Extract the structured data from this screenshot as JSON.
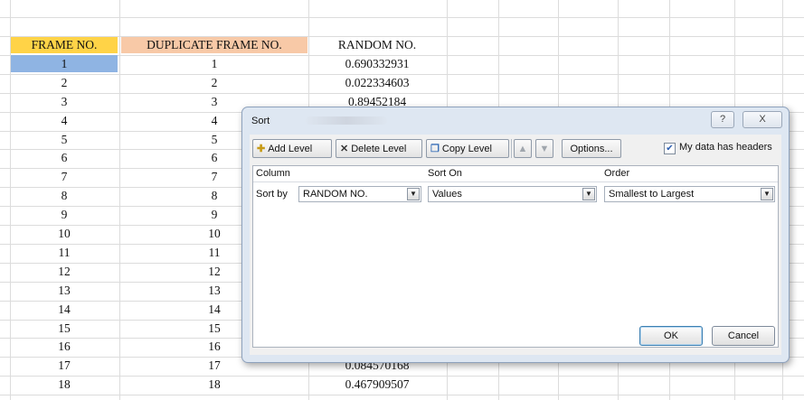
{
  "sheet": {
    "headers": {
      "col_a": "FRAME NO.",
      "col_b": "DUPLICATE FRAME NO.",
      "col_c": "RANDOM NO."
    },
    "rows": [
      {
        "a": "1",
        "b": "1",
        "c": "0.690332931"
      },
      {
        "a": "2",
        "b": "2",
        "c": "0.022334603"
      },
      {
        "a": "3",
        "b": "3",
        "c": "0.89452184"
      },
      {
        "a": "4",
        "b": "4",
        "c": ""
      },
      {
        "a": "5",
        "b": "5",
        "c": ""
      },
      {
        "a": "6",
        "b": "6",
        "c": ""
      },
      {
        "a": "7",
        "b": "7",
        "c": ""
      },
      {
        "a": "8",
        "b": "8",
        "c": ""
      },
      {
        "a": "9",
        "b": "9",
        "c": ""
      },
      {
        "a": "10",
        "b": "10",
        "c": ""
      },
      {
        "a": "11",
        "b": "11",
        "c": ""
      },
      {
        "a": "12",
        "b": "12",
        "c": ""
      },
      {
        "a": "13",
        "b": "13",
        "c": ""
      },
      {
        "a": "14",
        "b": "14",
        "c": ""
      },
      {
        "a": "15",
        "b": "15",
        "c": ""
      },
      {
        "a": "16",
        "b": "16",
        "c": ""
      },
      {
        "a": "17",
        "b": "17",
        "c": "0.084570168"
      },
      {
        "a": "18",
        "b": "18",
        "c": "0.467909507"
      }
    ],
    "colors": {
      "header_a": "#ffd347",
      "header_b": "#f8c9a7",
      "selected_cell": "#8fb4e3"
    }
  },
  "dialog": {
    "title": "Sort",
    "help_icon": "?",
    "close_icon": "X",
    "toolbar": {
      "add_level": "Add Level",
      "delete_level": "Delete Level",
      "copy_level": "Copy Level",
      "move_up_icon": "▲",
      "move_down_icon": "▼",
      "options": "Options..."
    },
    "my_data_has_headers": {
      "label": "My data has headers",
      "checked": true
    },
    "columns": {
      "column": "Column",
      "sort_on": "Sort On",
      "order": "Order"
    },
    "level": {
      "label": "Sort by",
      "column_value": "RANDOM NO.",
      "sort_on_value": "Values",
      "order_value": "Smallest to Largest"
    },
    "ok": "OK",
    "cancel": "Cancel"
  }
}
